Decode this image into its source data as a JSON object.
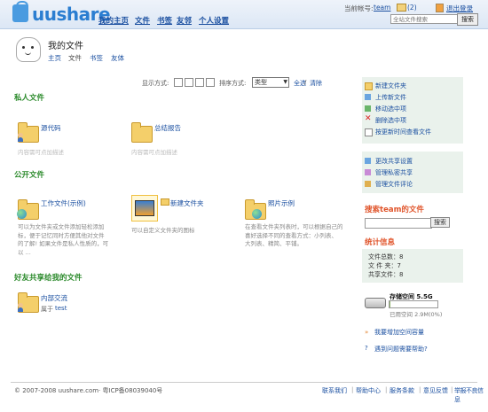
{
  "header": {
    "logo_text": "uushare",
    "nav": [
      "我的主页",
      "文件",
      "书签",
      "友邻",
      "个人设置"
    ],
    "account_label": "当前帐号:",
    "account_user": "team",
    "mail_count": "(2)",
    "logout": "退出登录",
    "search_placeholder": "全站文件搜索",
    "search_button": "搜索"
  },
  "title": {
    "page_title": "我的文件",
    "subtabs": [
      "主页",
      "文件",
      "书签",
      "友体"
    ]
  },
  "toolbar": {
    "view_label": "显示方式:",
    "sort_label": "排序方式:",
    "sort_value": "类型",
    "select_all": "全选",
    "clear": "清除",
    "separator": "/"
  },
  "sections": {
    "private": {
      "title": "私人文件",
      "items": [
        {
          "name": "源代码",
          "desc": "内容需可点加描述"
        },
        {
          "name": "总结报告",
          "desc": "内容需可点加描述"
        }
      ]
    },
    "public": {
      "title": "公开文件",
      "items": [
        {
          "name": "工作文件(示例)",
          "text": [
            "可以为文件夹或文件添加轻松添加",
            "标，便于记忆同时方便其他对文件",
            "的了解! 如果文件是私人性质的，可",
            "以 ..."
          ]
        },
        {
          "name": "新建文件夹",
          "text": [
            "可以自定义文件夹的图标"
          ]
        },
        {
          "name": "照片示例",
          "text": [
            "在查看文件夹列表时，可以根据自己的",
            "喜好选择不同的查看方式：小列表、",
            "大列表、精简、平铺。"
          ]
        }
      ]
    },
    "shared": {
      "title": "好友共享给我的文件",
      "items": [
        {
          "name": "内部交流",
          "owner_label": "属于",
          "owner": "test"
        }
      ]
    }
  },
  "sidebar": {
    "actions": [
      "新建文件夹",
      "上传新文件",
      "移动选中项",
      "删除选中项",
      "按更新时间查看文件"
    ],
    "share_actions": [
      "更改共享设置",
      "管理私密共享",
      "管理文件评论"
    ],
    "search_title": "搜索team的文件",
    "search_button": "搜索",
    "stats_title": "统计信息",
    "stats": [
      "文件总数：8",
      "文 件 夹：7",
      "共享文件：8"
    ],
    "storage_label": "存储空间  5.5G",
    "storage_used_fraction": 0.0053,
    "used_label": "已用空间  2.9M(0%)",
    "more_space": "我要增加空间容量",
    "help": "遇到问题需要帮助?"
  },
  "footer": {
    "copyright": "© 2007-2008 uushare.com· 粤ICP备08039040号",
    "links": [
      "联系我们",
      "帮助中心",
      "服务条款",
      "意见反馈",
      "举报不良信息"
    ],
    "separator": "|"
  }
}
